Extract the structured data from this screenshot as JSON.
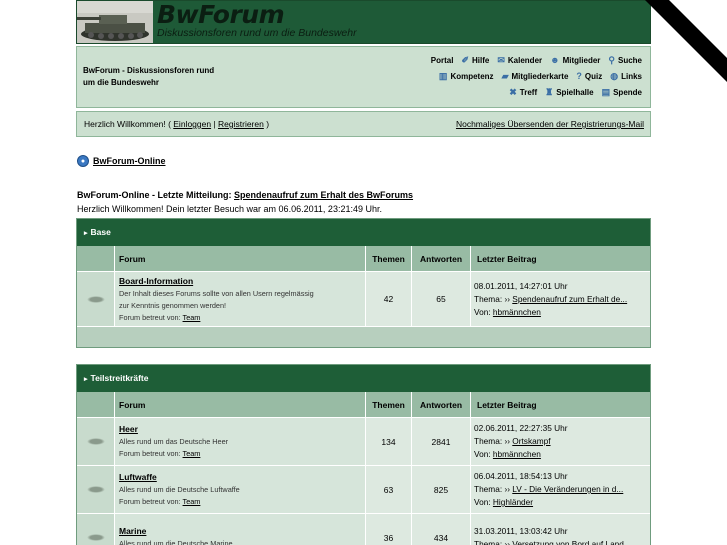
{
  "header": {
    "title": "BwForum",
    "subtitle": "Diskussionsforen rund um die Bundeswehr"
  },
  "menubar": {
    "description_line1": "BwForum - Diskussionsforen rund",
    "description_line2": "um die Bundeswehr",
    "row1": [
      {
        "label": "Portal",
        "icon": "portal-icon",
        "glyph": ""
      },
      {
        "label": "Hilfe",
        "icon": "help-icon",
        "glyph": "✐"
      },
      {
        "label": "Kalender",
        "icon": "calendar-icon",
        "glyph": "✉"
      },
      {
        "label": "Mitglieder",
        "icon": "members-icon",
        "glyph": "☻"
      },
      {
        "label": "Suche",
        "icon": "search-icon",
        "glyph": "⚲"
      }
    ],
    "row2": [
      {
        "label": "Kompetenz",
        "icon": "competence-icon",
        "glyph": "▥"
      },
      {
        "label": "Mitgliederkarte",
        "icon": "member-map-icon",
        "glyph": "▰"
      },
      {
        "label": "Quiz",
        "icon": "quiz-icon",
        "glyph": "?"
      },
      {
        "label": "Links",
        "icon": "links-icon",
        "glyph": "◍"
      }
    ],
    "row3": [
      {
        "label": "Treff",
        "icon": "meeting-icon",
        "glyph": "✖"
      },
      {
        "label": "Spielhalle",
        "icon": "arcade-icon",
        "glyph": "♜"
      },
      {
        "label": "Spende",
        "icon": "donate-icon",
        "glyph": "▤"
      }
    ]
  },
  "loginbar": {
    "welcome_prefix": "Herzlich Willkommen! ( ",
    "login": "Einloggen",
    "separator": " | ",
    "register": "Registrieren",
    "welcome_suffix": " )",
    "resend": "Nochmaliges Übersenden der Registrierungs-Mail"
  },
  "breadcrumb": {
    "label": "BwForum-Online"
  },
  "lastmsg": {
    "prefix": "BwForum-Online - Letzte Mitteilung: ",
    "link": "Spendenaufruf zum Erhalt des BwForums",
    "welcome": "Herzlich Willkommen! Dein letzter Besuch war am 06.06.2011, 23:21:49 Uhr."
  },
  "columns": {
    "forum": "Forum",
    "themen": "Themen",
    "antworten": "Antworten",
    "last": "Letzter Beitrag"
  },
  "labels": {
    "thema": "Thema: ",
    "von": "Von: ",
    "betreut": "Forum betreut von: ",
    "arrow": "››"
  },
  "categories": [
    {
      "name": "Base",
      "forums": [
        {
          "name": "Board-Information",
          "desc1": "Der Inhalt dieses Forums sollte von allen Usern regelmässig",
          "desc2": "zur Kenntnis genommen werden!",
          "mod": "Team",
          "themen": "42",
          "antworten": "65",
          "date": "08.01.2011, 14:27:01 Uhr",
          "thread": "Spendenaufruf zum Erhalt de...",
          "user": "hbmännchen"
        }
      ]
    },
    {
      "name": "Teilstreitkräfte",
      "forums": [
        {
          "name": "Heer",
          "desc1": "Alles rund um das Deutsche Heer",
          "desc2": "",
          "mod": "Team",
          "themen": "134",
          "antworten": "2841",
          "date": "02.06.2011, 22:27:35 Uhr",
          "thread": "Ortskampf",
          "user": "hbmännchen"
        },
        {
          "name": "Luftwaffe",
          "desc1": "Alles rund um die Deutsche Luftwaffe",
          "desc2": "",
          "mod": "Team",
          "themen": "63",
          "antworten": "825",
          "date": "06.04.2011, 18:54:13 Uhr",
          "thread": "LV - Die Veränderungen in d...",
          "user": "Highländer"
        },
        {
          "name": "Marine",
          "desc1": "Alles rund um die Deutsche Marine",
          "desc2": "",
          "mod": "",
          "themen": "36",
          "antworten": "434",
          "date": "31.03.2011, 13:03:42 Uhr",
          "thread": "Versetzung von Bord auf Land",
          "user": ""
        }
      ]
    }
  ]
}
